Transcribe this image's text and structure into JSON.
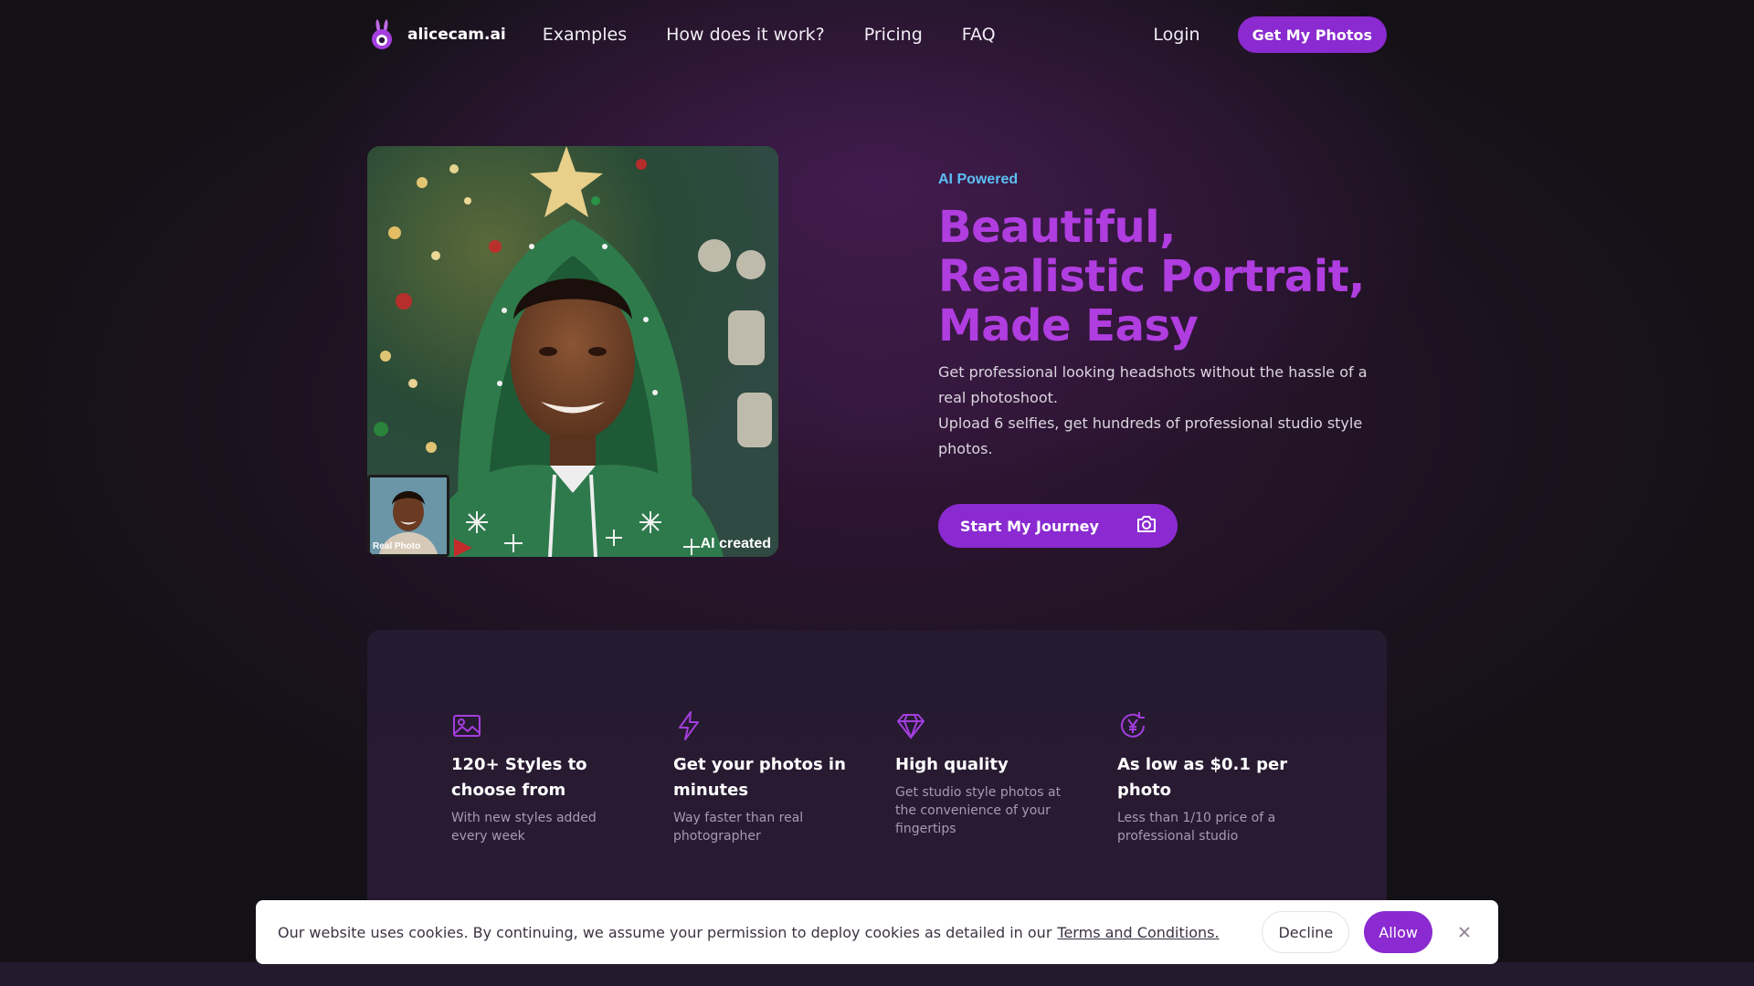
{
  "brand": {
    "name": "alicecam.ai",
    "logo_icon": "bunny-camera-logo-icon"
  },
  "nav": {
    "links": [
      "Examples",
      "How does it work?",
      "Pricing",
      "FAQ"
    ],
    "login": "Login",
    "cta": "Get My Photos"
  },
  "hero": {
    "image_labels": {
      "real": "Real Photo",
      "ai": "AI created"
    },
    "eyebrow": "AI Powered",
    "headline_lines": [
      "Beautiful,",
      "Realistic Portrait,",
      "Made Easy"
    ],
    "description_lines": [
      "Get professional looking headshots without the hassle of a",
      "real photoshoot.",
      "Upload 6 selfies, get hundreds of professional studio style",
      "photos."
    ],
    "cta": "Start My Journey",
    "cta_icon": "camera-icon"
  },
  "features": [
    {
      "icon": "image-icon",
      "title": "120+ Styles to choose from",
      "subtitle": "With new styles added every week"
    },
    {
      "icon": "lightning-icon",
      "title": "Get your photos in minutes",
      "subtitle": "Way faster than real photographer"
    },
    {
      "icon": "diamond-icon",
      "title": "High quality",
      "subtitle": "Get studio style photos at the convenience of your fingertips"
    },
    {
      "icon": "currency-cycle-icon",
      "title": "As low as $0.1 per photo",
      "subtitle": "Less than 1/10 price of a professional studio"
    }
  ],
  "cookie": {
    "text": "Our website uses cookies. By continuing, we assume your permission to deploy cookies as detailed in our",
    "link": "Terms and Conditions.",
    "decline": "Decline",
    "allow": "Allow",
    "close_icon": "close-icon"
  },
  "colors": {
    "accent": "#8a2ad0",
    "headline": "#b03de0",
    "eyebrow": "#5cc0f5"
  }
}
